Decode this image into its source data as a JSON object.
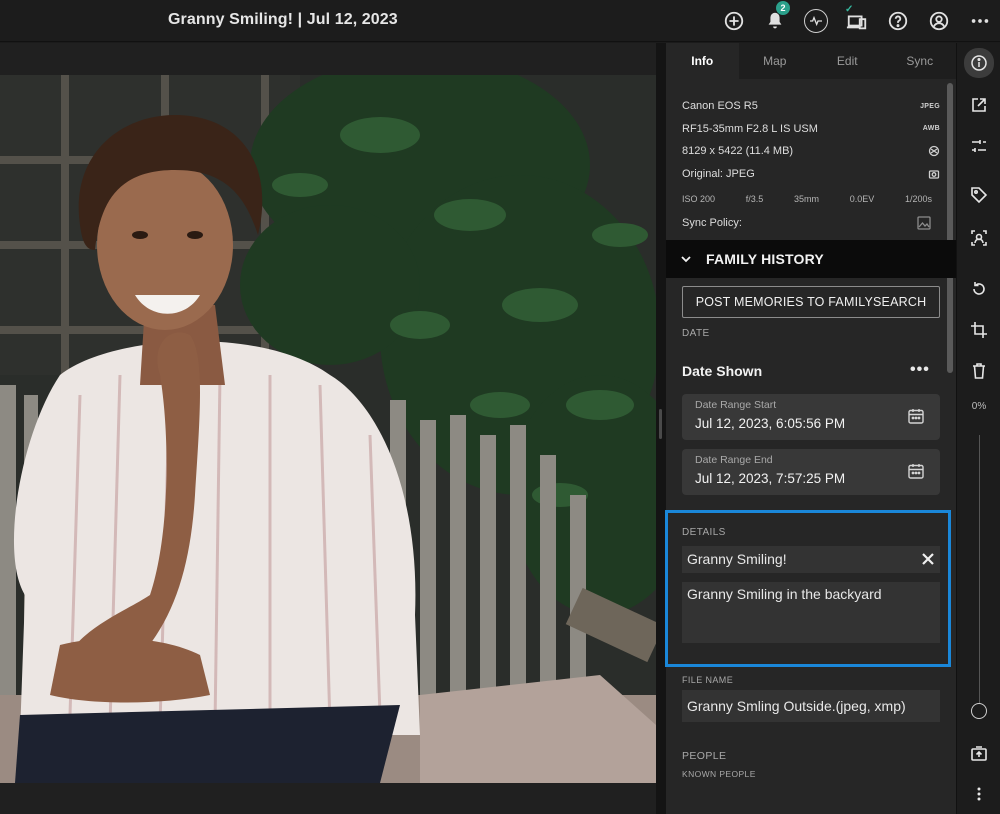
{
  "header": {
    "title": "Granny Smiling! | Jul 12, 2023",
    "notification_count": "2",
    "icons": [
      "add-circle-icon",
      "bell-icon",
      "activity-icon",
      "devices-check-icon",
      "help-icon",
      "account-icon",
      "more-icon"
    ]
  },
  "tabs": [
    {
      "label": "Info",
      "active": true
    },
    {
      "label": "Map",
      "active": false
    },
    {
      "label": "Edit",
      "active": false
    },
    {
      "label": "Sync",
      "active": false
    }
  ],
  "metadata": {
    "camera": "Canon EOS R5",
    "camera_badge": "JPEG",
    "lens": "RF15-35mm F2.8 L IS USM",
    "lens_badge": "AWB",
    "dimensions": "8129 x 5422 (11.4 MB)",
    "original": "Original: JPEG",
    "exif": {
      "iso": "ISO 200",
      "aperture": "f/3.5",
      "focal": "35mm",
      "ev": "0.0EV",
      "shutter": "1/200s"
    },
    "sync_policy_label": "Sync Policy:"
  },
  "family_history": {
    "header": "FAMILY HISTORY",
    "post_button": "POST MEMORIES TO FAMILYSEARCH",
    "date_label": "DATE",
    "date_shown": "Date Shown",
    "more_glyph": "•••",
    "range_start_label": "Date Range Start",
    "range_start_value": "Jul 12, 2023, 6:05:56 PM",
    "range_end_label": "Date Range End",
    "range_end_value": "Jul 12, 2023, 7:57:25 PM"
  },
  "details": {
    "label": "DETAILS",
    "title_value": "Granny Smiling!",
    "description_value": "Granny Smiling in the backyard"
  },
  "file": {
    "label": "FILE NAME",
    "value": "Granny Smling Outside.(jpeg, xmp)"
  },
  "people": {
    "label": "PEOPLE",
    "sublabel": "KNOWN PEOPLE"
  },
  "rail": {
    "zoom": "0%",
    "zoom_fraction": 0,
    "icons": [
      "info-icon",
      "open-external-icon",
      "adjust-sliders-icon",
      "tag-icon",
      "face-scan-icon",
      "rotate-icon",
      "crop-icon",
      "delete-icon",
      "battery-icon",
      "more-vertical-icon"
    ]
  },
  "colors": {
    "accent_highlight": "#1a87d9",
    "badge": "#2ba08b"
  }
}
